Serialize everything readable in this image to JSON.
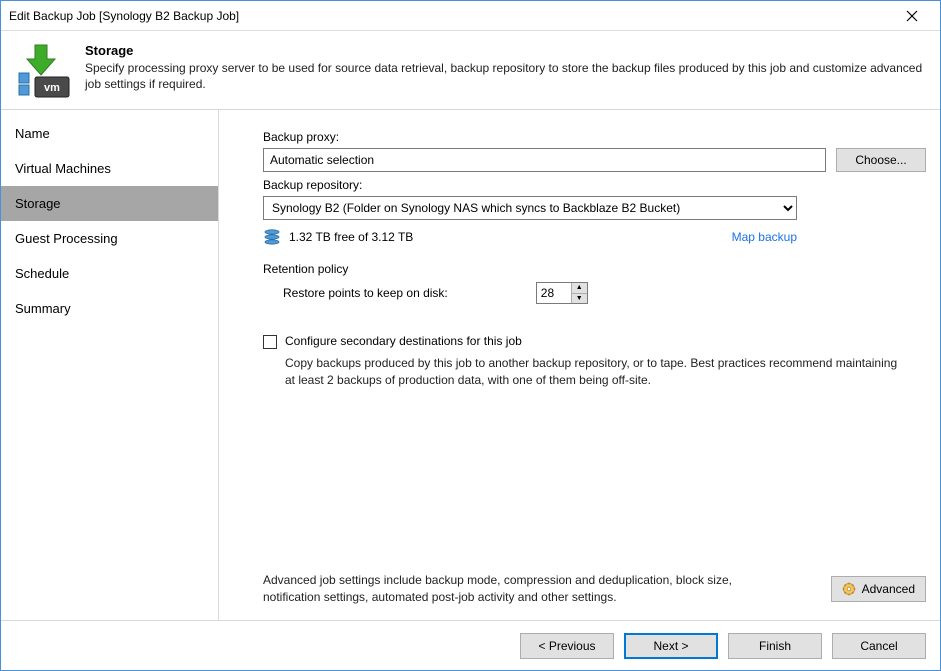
{
  "window": {
    "title": "Edit Backup Job [Synology B2 Backup Job]"
  },
  "header": {
    "title": "Storage",
    "description": "Specify processing proxy server to be used for source data retrieval, backup repository to store the backup files produced by this job and customize advanced job settings if required."
  },
  "sidebar": {
    "items": [
      {
        "label": "Name"
      },
      {
        "label": "Virtual Machines"
      },
      {
        "label": "Storage"
      },
      {
        "label": "Guest Processing"
      },
      {
        "label": "Schedule"
      },
      {
        "label": "Summary"
      }
    ],
    "active_index": 2
  },
  "content": {
    "proxy_label": "Backup proxy:",
    "proxy_value": "Automatic selection",
    "choose_label": "Choose...",
    "repo_label": "Backup repository:",
    "repo_value": "Synology B2 (Folder on Synology NAS which syncs to Backblaze B2 Bucket)",
    "storage_free": "1.32 TB free of 3.12 TB",
    "map_backup": "Map backup",
    "retention_label": "Retention policy",
    "restore_points_label": "Restore points to keep on disk:",
    "restore_points_value": "28",
    "secondary_checkbox_label": "Configure secondary destinations for this job",
    "secondary_desc": "Copy backups produced by this job to another backup repository, or to tape. Best practices recommend maintaining at least 2 backups of production data, with one of them being off-site.",
    "advanced_note": "Advanced job settings include backup mode, compression and deduplication, block size, notification settings, automated post-job activity and other settings.",
    "advanced_label": "Advanced"
  },
  "footer": {
    "previous": "< Previous",
    "next": "Next >",
    "finish": "Finish",
    "cancel": "Cancel"
  }
}
